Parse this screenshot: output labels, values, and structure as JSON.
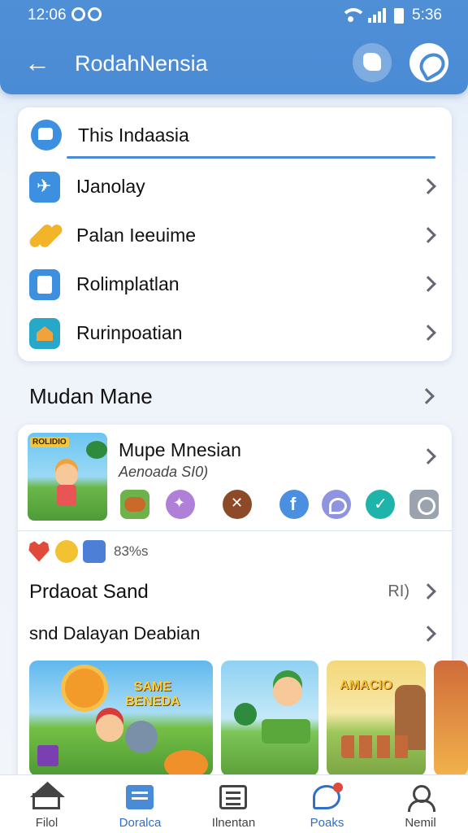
{
  "status": {
    "time": "12:06",
    "right_time": "5:36"
  },
  "appbar": {
    "title": "RodahNensia"
  },
  "search": {
    "text": "This Indaasia"
  },
  "menu": {
    "items": [
      {
        "label": "Ĳanolay",
        "icon": "plane-icon"
      },
      {
        "label": "Palan Ieeuime",
        "icon": "pills-icon"
      },
      {
        "label": "Rolimplatlan",
        "icon": "note-icon"
      },
      {
        "label": "Rurinpoatian",
        "icon": "house-icon"
      }
    ]
  },
  "section": {
    "title": "Mudan Mane"
  },
  "game": {
    "thumb_badge": "ROLIDIO",
    "title": "Mupe Mnesian",
    "subtitle": "Aenoada SI0)",
    "icons": [
      "food-icon",
      "star-icon",
      "cross-icon",
      "facebook-icon",
      "chat-icon",
      "check-icon",
      "profile-icon"
    ]
  },
  "reactions": {
    "percent": "83%s"
  },
  "rows": [
    {
      "label": "Prdaoat Sand",
      "value": "RI)"
    },
    {
      "label": "snd Dalayan Deabian",
      "value": ""
    }
  ],
  "tiles": [
    {
      "logo": "SAME\nBENEDA"
    },
    {
      "logo": ""
    },
    {
      "logo": "AMACIO"
    },
    {
      "logo": ""
    }
  ],
  "nav": [
    {
      "label": "Filol",
      "icon": "home-icon"
    },
    {
      "label": "Doralca",
      "icon": "dashboard-icon"
    },
    {
      "label": "Ilnentan",
      "icon": "list-icon"
    },
    {
      "label": "Poaks",
      "icon": "chat-icon"
    },
    {
      "label": "Nemil",
      "icon": "user-icon"
    }
  ],
  "colors": {
    "accent": "#4a8bd5",
    "active_nav": "#2f6fc8"
  }
}
